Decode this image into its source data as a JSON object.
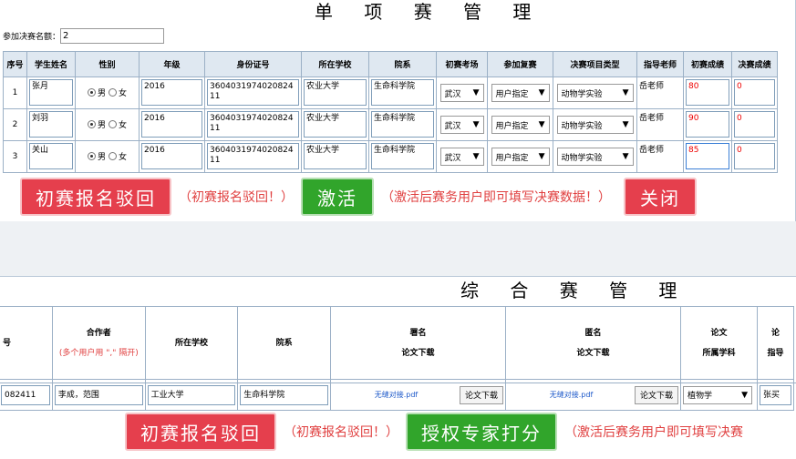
{
  "panel1": {
    "title": "单 项 赛 管 理",
    "quota_label": "参加决赛名额：",
    "quota_value": "2",
    "headers": [
      "序号",
      "学生姓名",
      "性别",
      "年级",
      "身份证号",
      "所在学校",
      "院系",
      "初赛考场",
      "参加复赛",
      "决赛项目类型",
      "指导老师",
      "初赛成绩",
      "决赛成绩"
    ],
    "gender_male": "男",
    "gender_female": "女",
    "rows": [
      {
        "no": "1",
        "name": "张月",
        "grade": "2016",
        "id": "360403197402082411",
        "school": "农业大学",
        "dept": "生命科学院",
        "venue": "武汉",
        "retest": "用户指定",
        "type": "动物学实验",
        "teacher": "岳老师",
        "score1": "80",
        "score2": "0"
      },
      {
        "no": "2",
        "name": "刘羽",
        "grade": "2016",
        "id": "360403197402082411",
        "school": "农业大学",
        "dept": "生命科学院",
        "venue": "武汉",
        "retest": "用户指定",
        "type": "动物学实验",
        "teacher": "岳老师",
        "score1": "90",
        "score2": "0"
      },
      {
        "no": "3",
        "name": "关山",
        "grade": "2016",
        "id": "360403197402082411",
        "school": "农业大学",
        "dept": "生命科学院",
        "venue": "武汉",
        "retest": "用户指定",
        "type": "动物学实验",
        "teacher": "岳老师",
        "score1": "85",
        "score2": "0"
      }
    ],
    "btn_reject": "初赛报名驳回",
    "hint_reject": "（初赛报名驳回！）",
    "btn_activate": "激活",
    "hint_activate": "（激活后赛务用户即可填写决赛数据！）",
    "btn_close": "关闭"
  },
  "panel2": {
    "title": "综 合 赛 管 理",
    "h_no": "号",
    "h_coauthor": "合作者",
    "h_coauthor_note": "(多个用户用 \",\" 隔开)",
    "h_school": "所在学校",
    "h_dept": "院系",
    "h_signed_1": "署名",
    "h_signed_2": "论文下载",
    "h_anon_1": "匿名",
    "h_anon_2": "论文下载",
    "h_subject_1": "论文",
    "h_subject_2": "所属学科",
    "h_teacher_1": "论",
    "h_teacher_2": "指导",
    "row": {
      "id_tail": "082411",
      "coauthors": "李成，范围",
      "school": "工业大学",
      "dept": "生命科学院",
      "signed_file": "无缝对接.pdf",
      "anon_file": "无缝对接.pdf",
      "download": "论文下载",
      "subject": "植物学",
      "teacher": "张买"
    },
    "btn_reject": "初赛报名驳回",
    "hint_reject": "（初赛报名驳回！）",
    "btn_expert": "授权专家打分",
    "hint_expert": "（激活后赛务用户即可填写决赛"
  }
}
